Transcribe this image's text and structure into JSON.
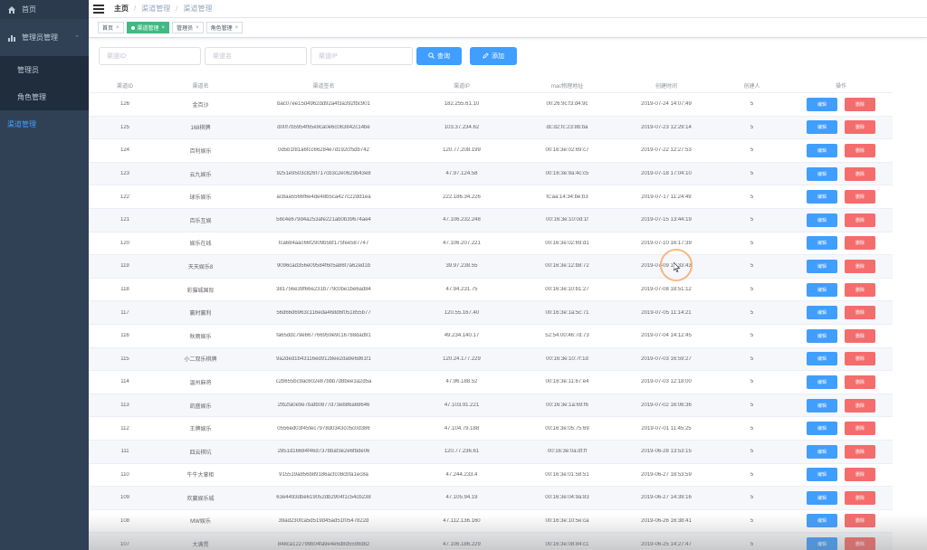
{
  "sidebar": {
    "home": "首页",
    "admin_group": "管理员管理",
    "admin": "管理员",
    "role": "角色管理",
    "channel": "渠道管理"
  },
  "breadcrumb": {
    "home": "主页",
    "level1": "渠道管理",
    "level2": "渠道管理"
  },
  "tags": [
    {
      "label": "首页"
    },
    {
      "label": "渠道管理"
    },
    {
      "label": "管理员"
    },
    {
      "label": "角色管理"
    }
  ],
  "filters": {
    "channel_id_placeholder": "渠道ID",
    "channel_name_placeholder": "渠道名",
    "channel_ip_placeholder": "渠道IP",
    "search_label": "查询",
    "add_label": "添加"
  },
  "table": {
    "headers": [
      "渠道ID",
      "渠道名",
      "渠道签名",
      "渠道IP",
      "mac物理地址",
      "创建时间",
      "创建人",
      "操作"
    ],
    "edit_label": "编辑",
    "delete_label": "删除",
    "rows": [
      [
        "126",
        "金百沙",
        "bac07ee15d4962dd92a4f3a392fbc901",
        "182.255.61.10",
        "00:26:9c:f3:d4:9c",
        "2019-07-24 14:07:49",
        "5"
      ],
      [
        "125",
        "168棋牌",
        "d00f7b5954f65e9ca0e6c063842c14be",
        "103.37.234.62",
        "dc:d2:fc:23:8b:ba",
        "2019-07-23 12:29:14",
        "5"
      ],
      [
        "124",
        "百利娱乐",
        "0d5b1f81a6fcc66284e7d192cf5db742",
        "120.77.208.199",
        "00:16:3e:02:69:c7",
        "2019-07-22 12:27:53",
        "5"
      ],
      [
        "123",
        "云九娱乐",
        "9251e9503c826f717cb3c2e0629b43e8",
        "47.97.124.58",
        "00:16:3e:9a:4c:c5",
        "2019-07-18 17:04:10",
        "5"
      ],
      [
        "122",
        "球乐娱乐",
        "ac8aa5566f6e4de48b5ca427c22dd1ea",
        "222.186.34.226",
        "fc:aa:14:34:be:b3",
        "2019-07-17 11:24:49",
        "5"
      ],
      [
        "121",
        "百乐互娱",
        "58c4e679d4a253afe221ab0b39674ae4",
        "47.106.232.248",
        "00:16:3e:10:0d:1f",
        "2019-07-15 13:44:19",
        "5"
      ],
      [
        "120",
        "娱乐在线",
        "fca684aac66f2909b5bf175fee587747",
        "47.106.207.221",
        "00:16:3e:02:69:d1",
        "2019-07-10 16:17:39",
        "5"
      ],
      [
        "119",
        "天天娱乐8",
        "9096cad356e09584f605a86f7a62ed1b",
        "39.97.238.55",
        "00:16:3e:12:b8:72",
        "2019-07-09 15:33:43",
        "5"
      ],
      [
        "118",
        "彩猫城国际",
        "381756e39f66e231b779c0be1be6ad84",
        "47.94.231.75",
        "00:16:3e:10:b1:27",
        "2019-07-08 18:51:12",
        "5"
      ],
      [
        "117",
        "赢时赢利",
        "56d66d6963c116eda468d6f051855b77",
        "120.55.167.40",
        "00:16:3e:1a:5c:71",
        "2019-07-05 11:14:21",
        "5"
      ],
      [
        "116",
        "秋雨娱乐",
        "fa65ddc79e667766959e9c16788dad91",
        "49.234.140.17",
        "52:54:00:46:7d:73",
        "2019-07-04 14:12:45",
        "5"
      ],
      [
        "115",
        "小二双乐棋牌",
        "9a2ded1b43116ed9128ee2da9e6d61f1",
        "120.24.177.229",
        "00:16:3e:10:7f:1d",
        "2019-07-03 16:59:27",
        "5"
      ],
      [
        "114",
        "温州麻将",
        "c2b655bc9ac602e87bbb7d8bee3a2d5a",
        "47.96.188.52",
        "00:16:3e:11:67:e4",
        "2019-07-03 12:18:00",
        "5"
      ],
      [
        "113",
        "凯盛娱乐",
        "2fb2fa0e9e7bafb0877d73eb86a68646",
        "47.103.91.221",
        "00:16:3e:1a:69:f6",
        "2019-07-02 16:06:36",
        "5"
      ],
      [
        "112",
        "王牌娱乐",
        "0556ed03f45fec7978d0343c05c0d386",
        "47.104.79.188",
        "00:16:3e:05:75:69",
        "2019-07-01 11:45:25",
        "5"
      ],
      [
        "111",
        "四云棋坑",
        "2851d16684f46d737bbaf3e2e6fbde06",
        "120.77.236.61",
        "00:16:3e:0a:df:ff",
        "2019-06-28 13:53:15",
        "5"
      ],
      [
        "110",
        "牛牛大掌柜",
        "915519a856b89186acfc08cbfa1ec8a",
        "47.244.233.4",
        "00:16:3e:01:58:51",
        "2019-06-27 18:53:59",
        "5"
      ],
      [
        "109",
        "欢赢娱乐城",
        "63e4493dbe619052db2904f1c54cb238",
        "47.105.94.19",
        "00:16:3e:04:9a:83",
        "2019-06-27 14:39:16",
        "5"
      ],
      [
        "108",
        "MW娱乐",
        "39ad230fca5d519d45ad51f0547822d",
        "47.112.136.160",
        "00:16:3e:10:5e:ca",
        "2019-06-26 16:38:41",
        "5"
      ],
      [
        "107",
        "大满贯",
        "848ca122799b04fa9e4e6d8d5598d82",
        "47.106.186.229",
        "00:16:3e:08:84:c1",
        "2019-06-25 14:27:47",
        "5"
      ]
    ]
  },
  "colors": {
    "sidebar_bg": "#304156",
    "primary": "#409eff",
    "danger": "#f56c6c",
    "active_tag": "#42b983"
  }
}
